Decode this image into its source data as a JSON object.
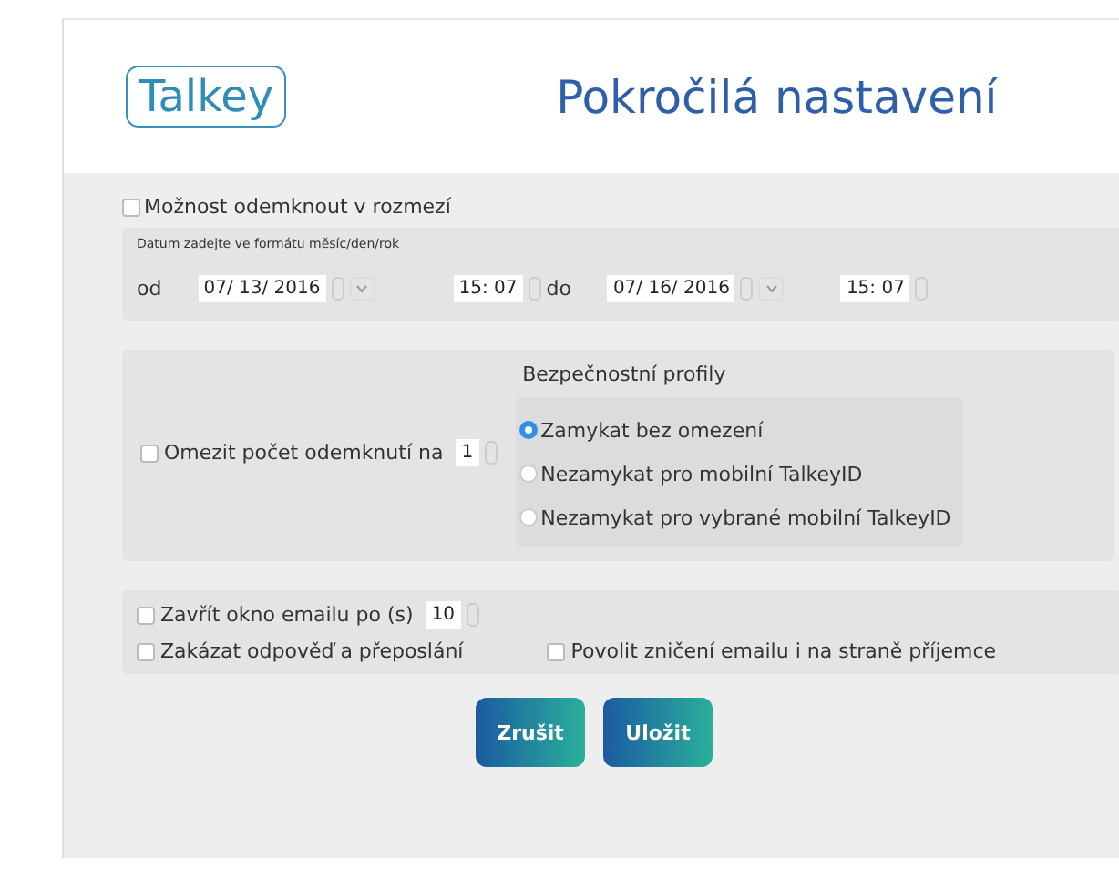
{
  "logo": "Talkey",
  "title": "Pokročilá nastavení",
  "range": {
    "label": "Možnost odemknout v rozmezí",
    "checked": false,
    "hint": "Datum zadejte ve formátu měsíc/den/rok",
    "from_label": "od",
    "from_date": "07/ 13/  2016",
    "from_time": "15: 07",
    "to_label": "do",
    "to_date": "07/ 16/  2016",
    "to_time": "15: 07"
  },
  "limit": {
    "label": "Omezit počet odemknutí na",
    "checked": false,
    "value": "1"
  },
  "profiles": {
    "title": "Bezpečnostní profily",
    "options": [
      {
        "label": "Zamykat bez omezení",
        "selected": true
      },
      {
        "label": "Nezamykat pro mobilní TalkeyID",
        "selected": false
      },
      {
        "label": "Nezamykat pro vybrané mobilní TalkeyID",
        "selected": false
      }
    ]
  },
  "close_window": {
    "label": "Zavřít okno emailu po (s)",
    "checked": false,
    "value": "10"
  },
  "disable_reply": {
    "label": "Zakázat odpověď a přeposlání",
    "checked": false
  },
  "allow_destroy": {
    "label": "Povolit zničení emailu i na straně příjemce",
    "checked": false
  },
  "buttons": [
    "Zrušit",
    "Uložit"
  ]
}
